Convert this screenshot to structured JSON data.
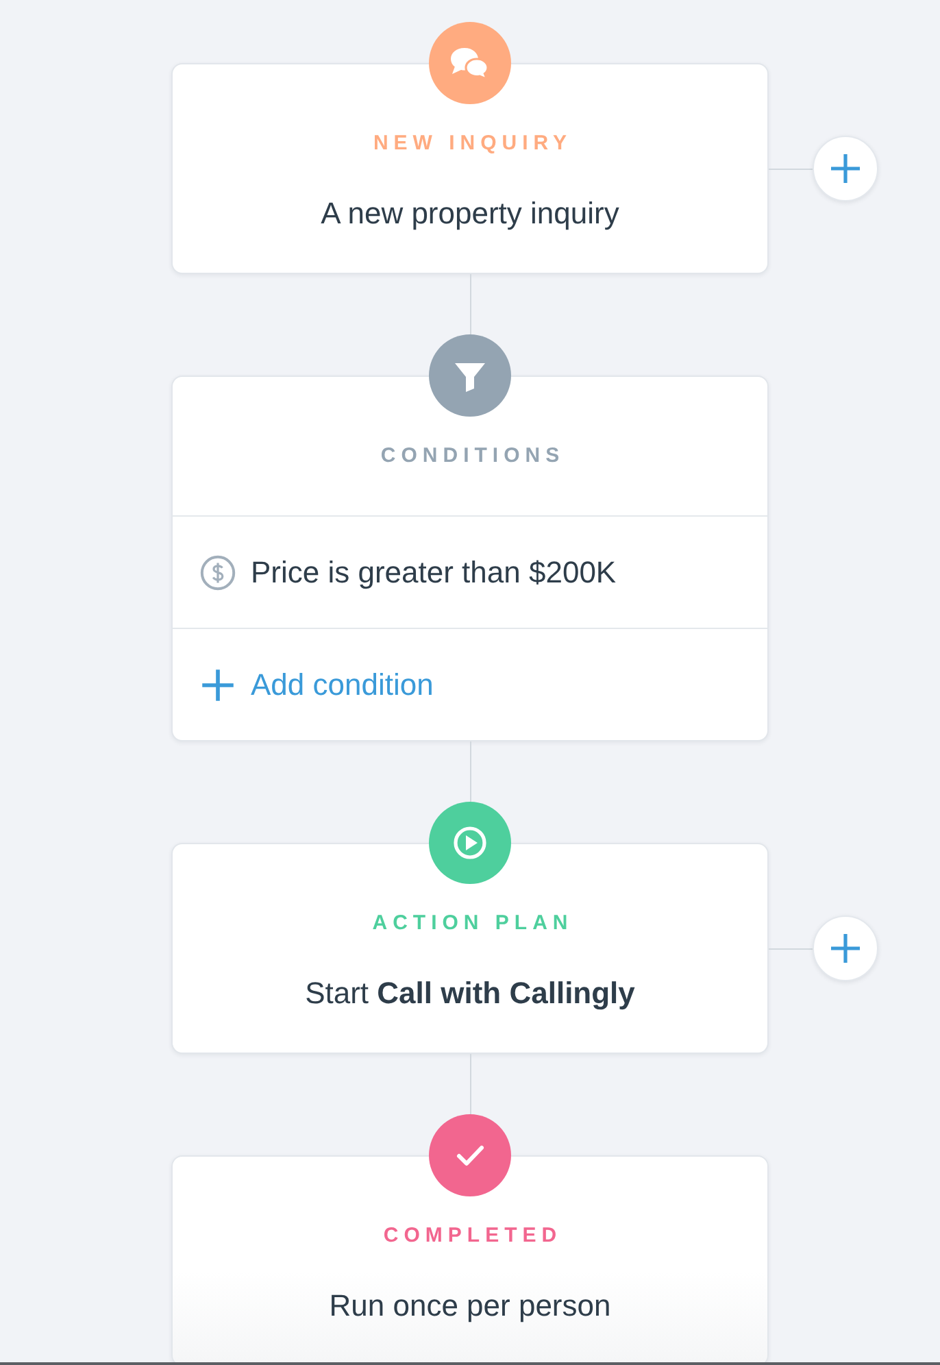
{
  "steps": [
    {
      "kind": "trigger",
      "color": "#ffab80",
      "title": "NEW INQUIRY",
      "description": "A new property inquiry",
      "add_button": true
    },
    {
      "kind": "conditions",
      "color": "#94a4b2",
      "title": "CONDITIONS",
      "conditions": [
        {
          "text": "Price is greater than $200K"
        }
      ],
      "add_condition": "Add condition",
      "add_button": false
    },
    {
      "kind": "action",
      "color": "#4ecf9d",
      "title": "ACTION PLAN",
      "description": "Start **Call with Callingly**",
      "add_button": true
    },
    {
      "kind": "completion",
      "color": "#f2668f",
      "title": "COMPLETED",
      "description": "Run once per person",
      "add_button": false
    }
  ]
}
